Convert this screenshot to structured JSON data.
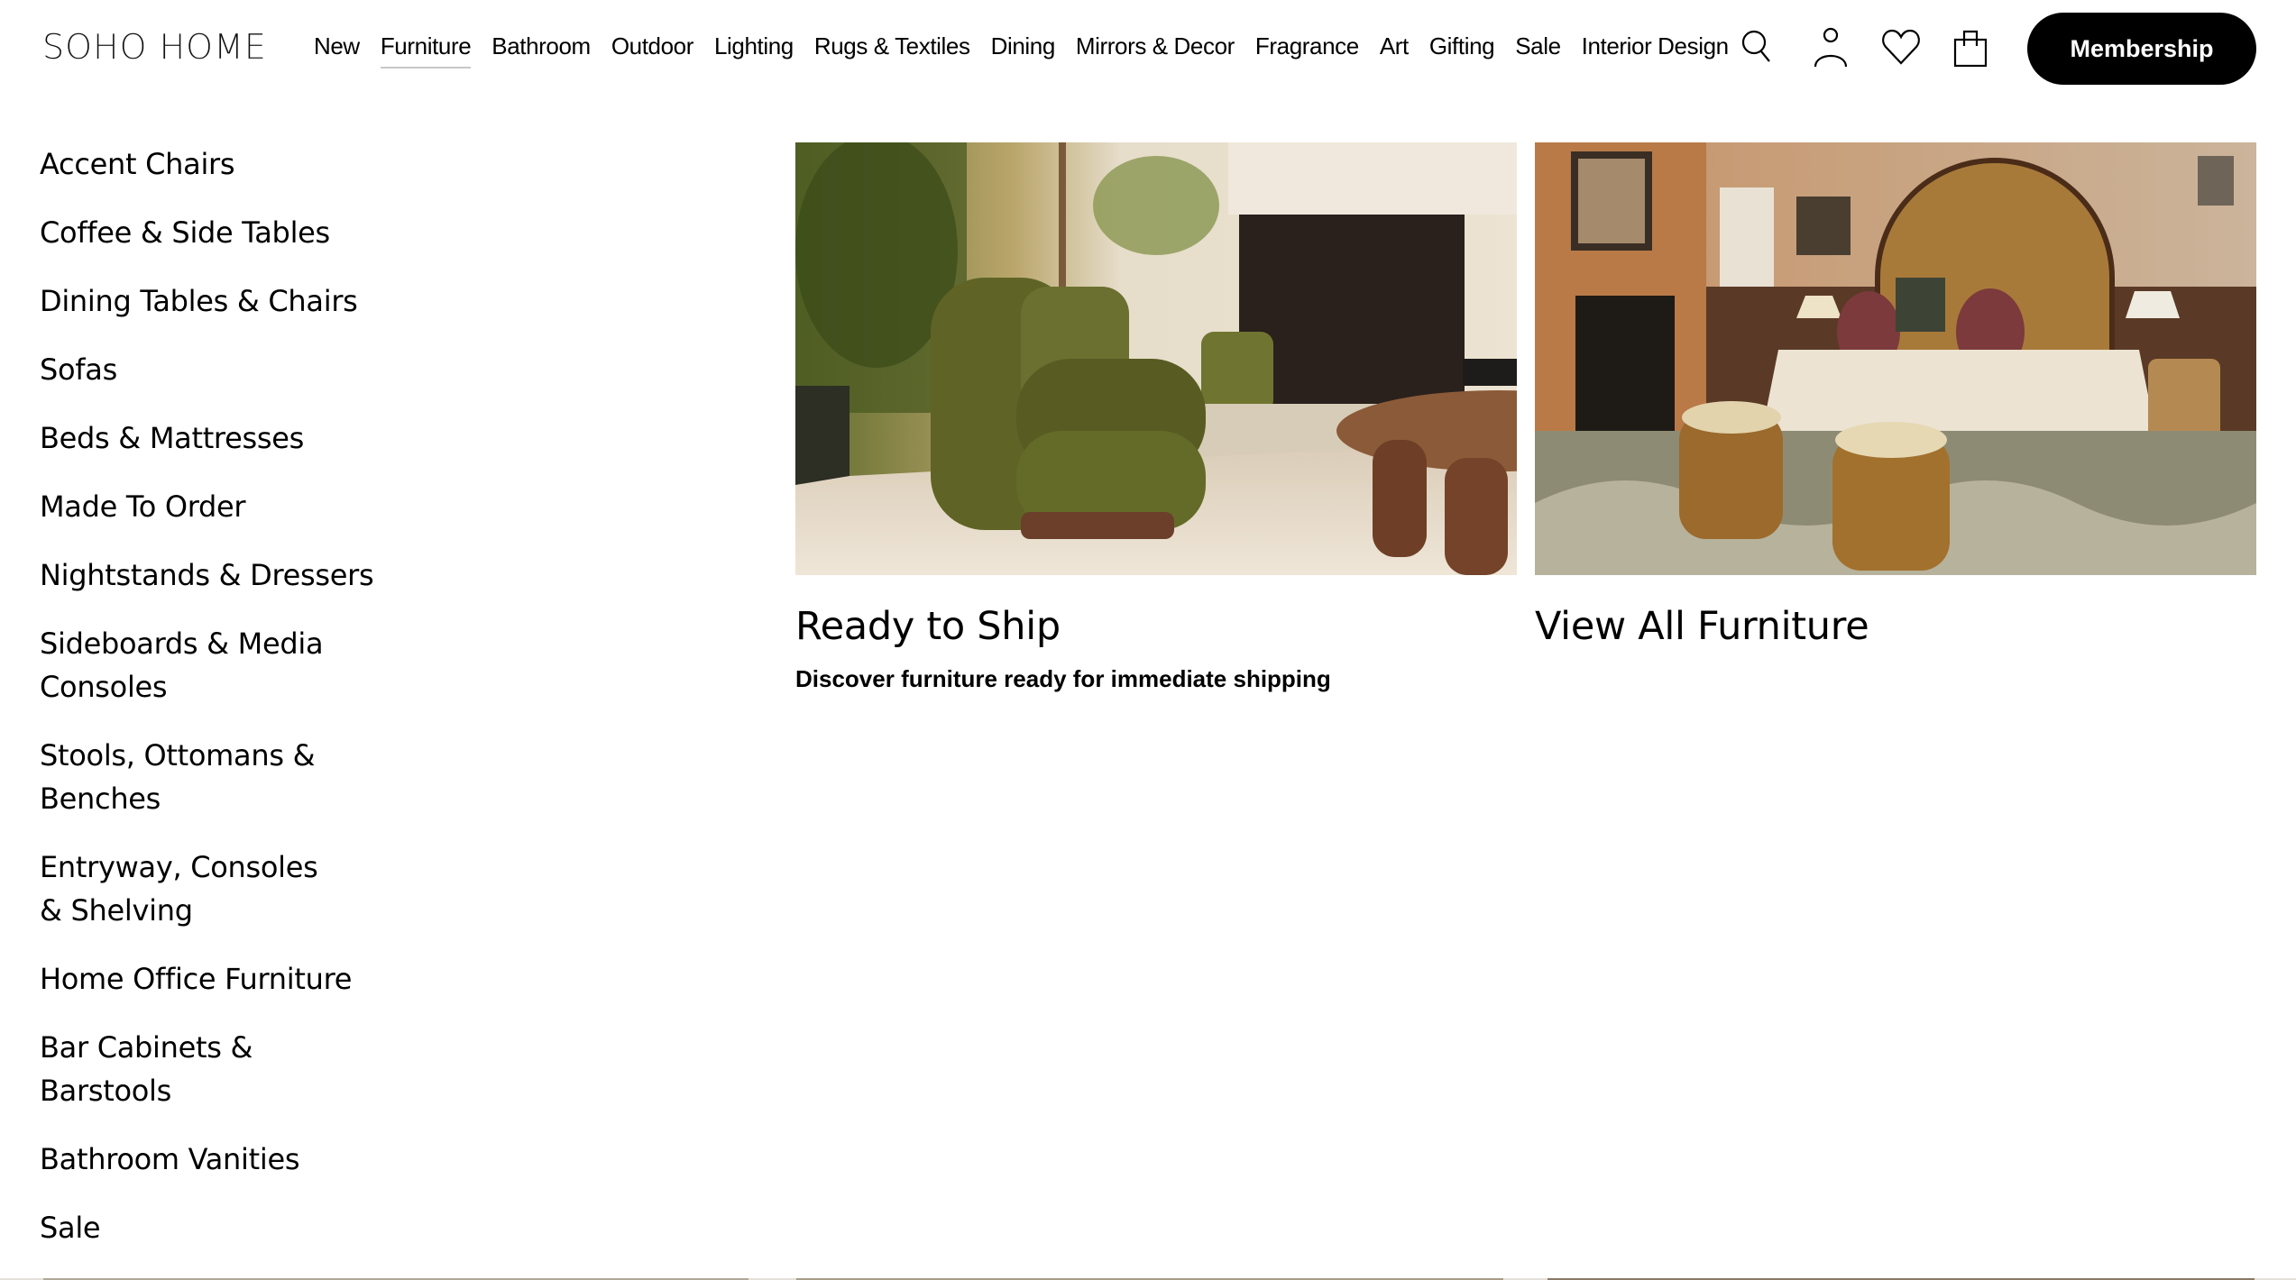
{
  "header": {
    "logo": "SOHO HOME",
    "nav": [
      {
        "label": "New",
        "active": false
      },
      {
        "label": "Furniture",
        "active": true
      },
      {
        "label": "Bathroom",
        "active": false
      },
      {
        "label": "Outdoor",
        "active": false
      },
      {
        "label": "Lighting",
        "active": false
      },
      {
        "label": "Rugs & Textiles",
        "active": false
      },
      {
        "label": "Dining",
        "active": false
      },
      {
        "label": "Mirrors & Decor",
        "active": false
      },
      {
        "label": "Fragrance",
        "active": false
      },
      {
        "label": "Art",
        "active": false
      },
      {
        "label": "Gifting",
        "active": false
      },
      {
        "label": "Sale",
        "active": false
      },
      {
        "label": "Interior Design",
        "active": false
      }
    ],
    "icons": [
      "search-icon",
      "account-icon",
      "wishlist-icon",
      "bag-icon"
    ],
    "membership_label": "Membership"
  },
  "menu": {
    "categories": [
      "Accent Chairs",
      "Coffee & Side Tables",
      "Dining Tables & Chairs",
      "Sofas",
      "Beds & Mattresses",
      "Made To Order",
      "Nightstands & Dressers",
      "Sideboards & Media Consoles",
      "Stools, Ottomans & Benches",
      "Entryway, Consoles & Shelving",
      "Home Office Furniture",
      "Bar Cabinets & Barstools",
      "Bathroom Vanities",
      "Sale"
    ],
    "features": [
      {
        "title": "Ready to Ship",
        "description": "Discover furniture ready for immediate shipping",
        "image": "living-room-green-velvet-armchair"
      },
      {
        "title": "View All Furniture",
        "description": "",
        "image": "bedroom-arched-headboard-bed-with-ottomans"
      }
    ]
  },
  "colors": {
    "accent": "#000000",
    "active_underline": "#c8c8c8",
    "background": "#ffffff"
  }
}
